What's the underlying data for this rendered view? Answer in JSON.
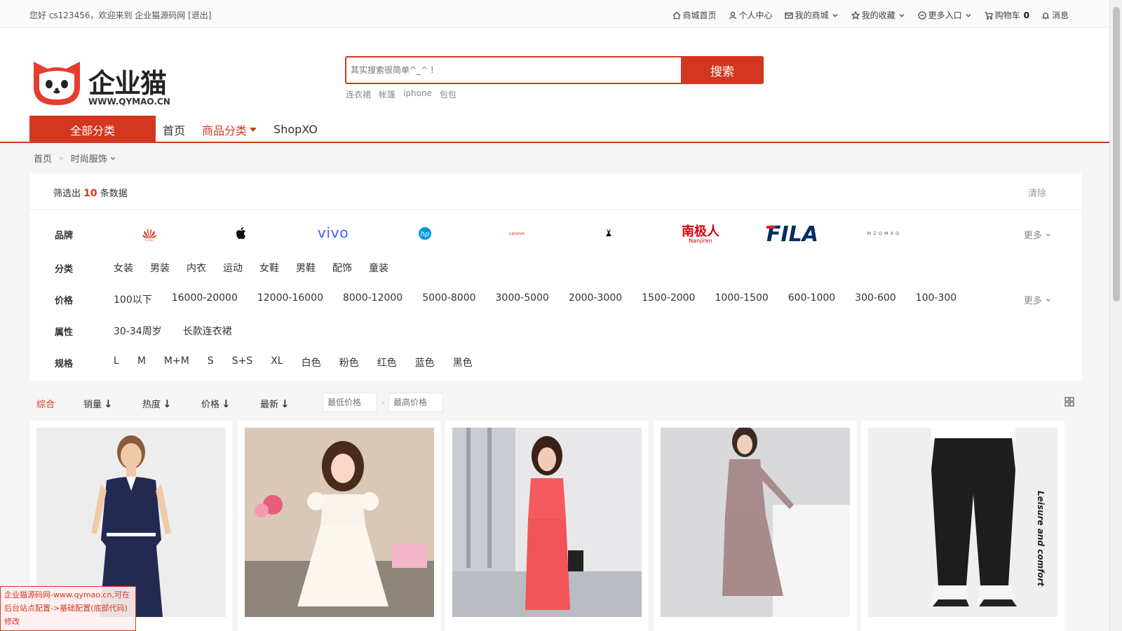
{
  "topbar": {
    "welcome": "您好 cs123456，欢迎来到 企业猫源码网",
    "logout": "[退出]",
    "nav": [
      {
        "label": "商城首页",
        "icon": "home-icon"
      },
      {
        "label": "个人中心",
        "icon": "user-icon"
      },
      {
        "label": "我的商城",
        "icon": "mail-icon"
      },
      {
        "label": "我的收藏",
        "icon": "star-icon"
      },
      {
        "label": "更多入口",
        "icon": "more-icon"
      },
      {
        "label": "购物车",
        "icon": "cart-icon",
        "count": "0"
      },
      {
        "label": "消息",
        "icon": "bell-icon"
      }
    ]
  },
  "logo": {
    "title": "企业猫",
    "subtitle": "WWW.QYMAO.CN",
    "color": "#e53d2f"
  },
  "search": {
    "placeholder": "其实搜索很简单^_^ !",
    "button": "搜索",
    "hotwords": [
      "连衣裙",
      "帐篷",
      "iphone",
      "包包"
    ]
  },
  "catnav": {
    "all": "全部分类",
    "links": [
      "首页",
      "商品分类",
      "ShopXO"
    ]
  },
  "breadcrumb": {
    "home": "首页",
    "current": "时尚服饰"
  },
  "filter": {
    "summary_prefix": "筛选出",
    "count": "10",
    "summary_suffix": "条数据",
    "clear": "清除",
    "more": "更多",
    "brand_label": "品牌",
    "brands": [
      {
        "name": "HUAWEI",
        "icon": "huawei-logo"
      },
      {
        "name": "Apple",
        "icon": "apple-logo"
      },
      {
        "name": "vivo",
        "icon": "vivo-logo"
      },
      {
        "name": "hp",
        "icon": "hp-logo"
      },
      {
        "name": "Lenovo",
        "icon": "lenovo-logo"
      },
      {
        "name": "Playboy",
        "icon": "playboy-logo"
      },
      {
        "name": "南极人",
        "sub": "Nanjiren",
        "icon": "nanjiren-logo"
      },
      {
        "name": "FILA",
        "icon": "fila-logo"
      },
      {
        "name": "M Z O M X O",
        "icon": "mzomxo-logo"
      }
    ],
    "category_label": "分类",
    "categories": [
      "女装",
      "男装",
      "内衣",
      "运动",
      "女鞋",
      "男鞋",
      "配饰",
      "童装"
    ],
    "price_label": "价格",
    "prices": [
      "100以下",
      "16000-20000",
      "12000-16000",
      "8000-12000",
      "5000-8000",
      "3000-5000",
      "2000-3000",
      "1500-2000",
      "1000-1500",
      "600-1000",
      "300-600",
      "100-300"
    ],
    "attr_label": "属性",
    "attrs": [
      "30-34周岁",
      "长款连衣裙"
    ],
    "spec_label": "规格",
    "specs": [
      "L",
      "M",
      "M+M",
      "S",
      "S+S",
      "XL",
      "白色",
      "粉色",
      "红色",
      "蓝色",
      "黑色"
    ]
  },
  "sort": {
    "items": [
      "综合",
      "销量",
      "热度",
      "价格",
      "最新"
    ],
    "min_price": "最低价格",
    "max_price": "最高价格"
  },
  "products": [
    {
      "name": "navy-polo-dress"
    },
    {
      "name": "white-lace-dress"
    },
    {
      "name": "coral-red-dress"
    },
    {
      "name": "mauve-knit-wrap-dress"
    },
    {
      "name": "black-jogger-pants",
      "overlay": "Leisure and comfort"
    }
  ],
  "watermark": "企业猫源码网-www.qymao.cn,可在后台站点配置->基础配置(底部代码)修改",
  "colors": {
    "accent": "#d4371f",
    "background": "#f5f5f5"
  }
}
